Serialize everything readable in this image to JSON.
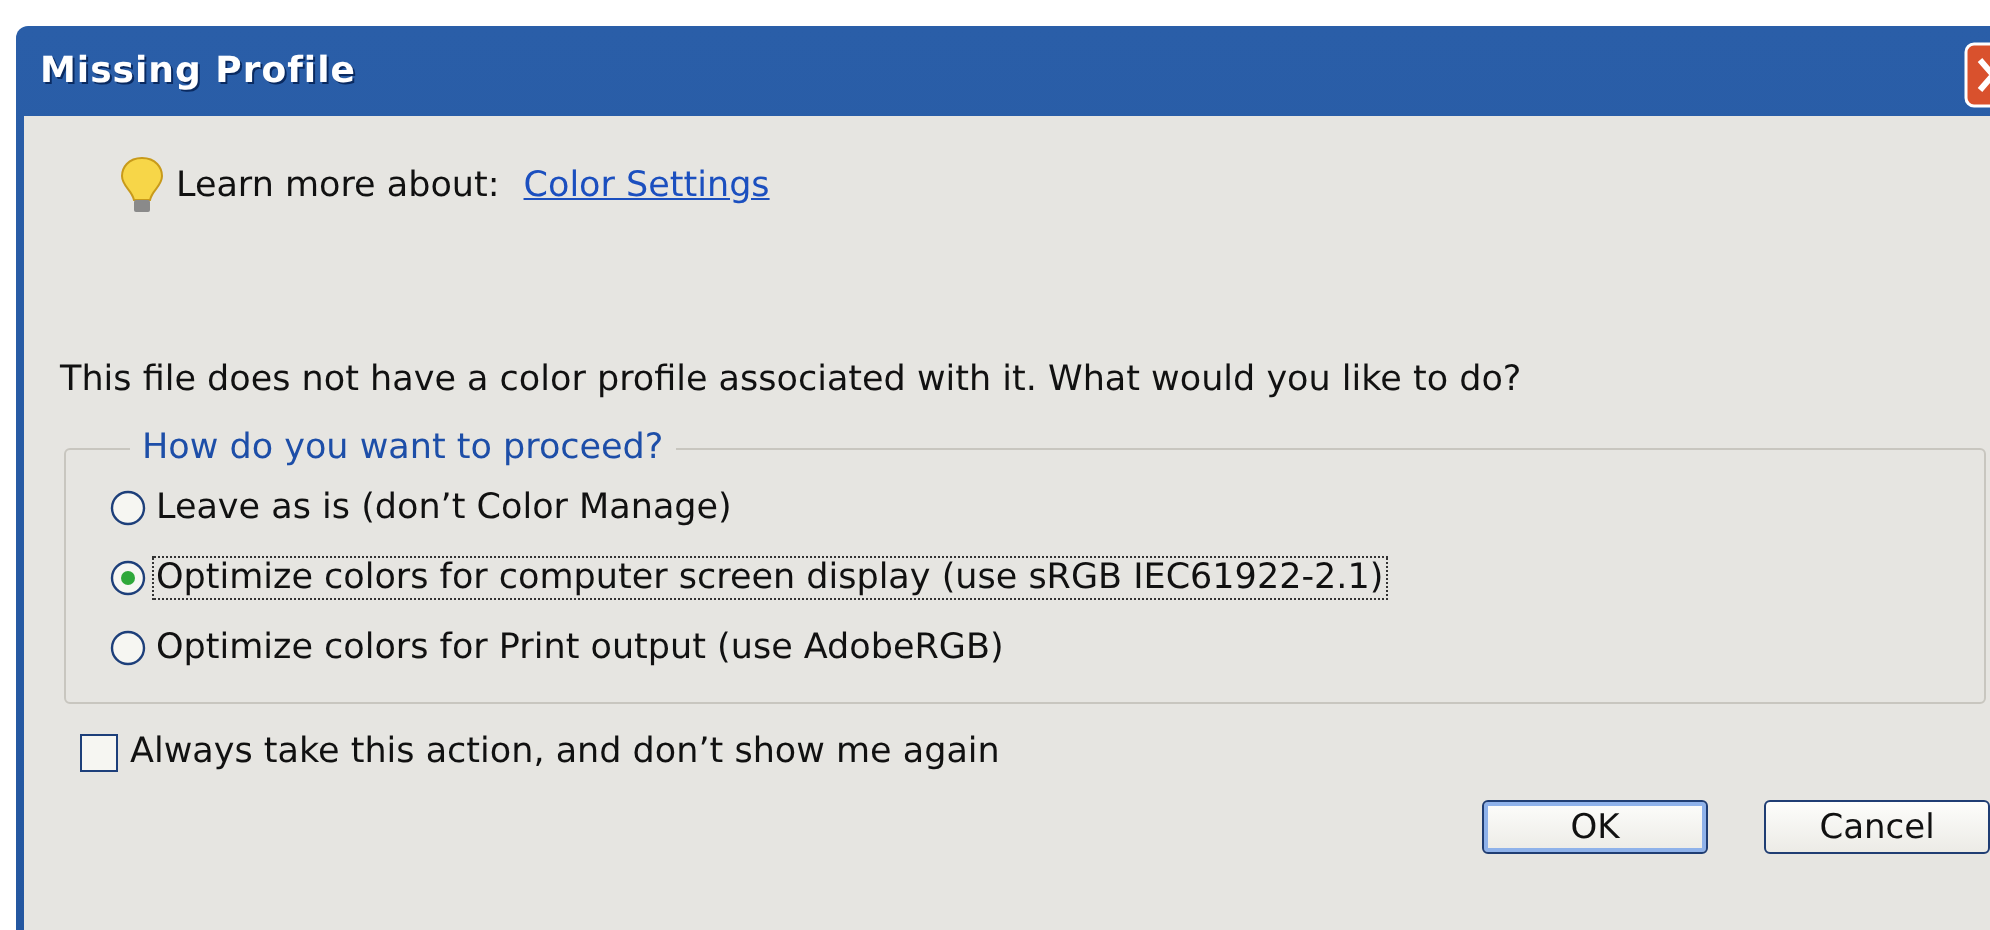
{
  "window": {
    "title": "Missing Profile"
  },
  "learn_more": {
    "label": "Learn more about:",
    "link": "Color Settings"
  },
  "message": "This file does not have a color profile associated with it. What would you like to do?",
  "group": {
    "legend": "How do you want to proceed?",
    "options": [
      {
        "label": "Leave as is (don’t Color Manage)",
        "selected": false,
        "focused": false
      },
      {
        "label": "Optimize colors for computer screen display (use sRGB IEC61922-2.1)",
        "selected": true,
        "focused": true
      },
      {
        "label": "Optimize colors for Print output (use AdobeRGB)",
        "selected": false,
        "focused": false
      }
    ]
  },
  "always": {
    "label": "Always take this action, and don’t show me again",
    "checked": false
  },
  "buttons": [
    {
      "label": "OK",
      "default": true
    },
    {
      "label": "Cancel",
      "default": false
    }
  ]
}
